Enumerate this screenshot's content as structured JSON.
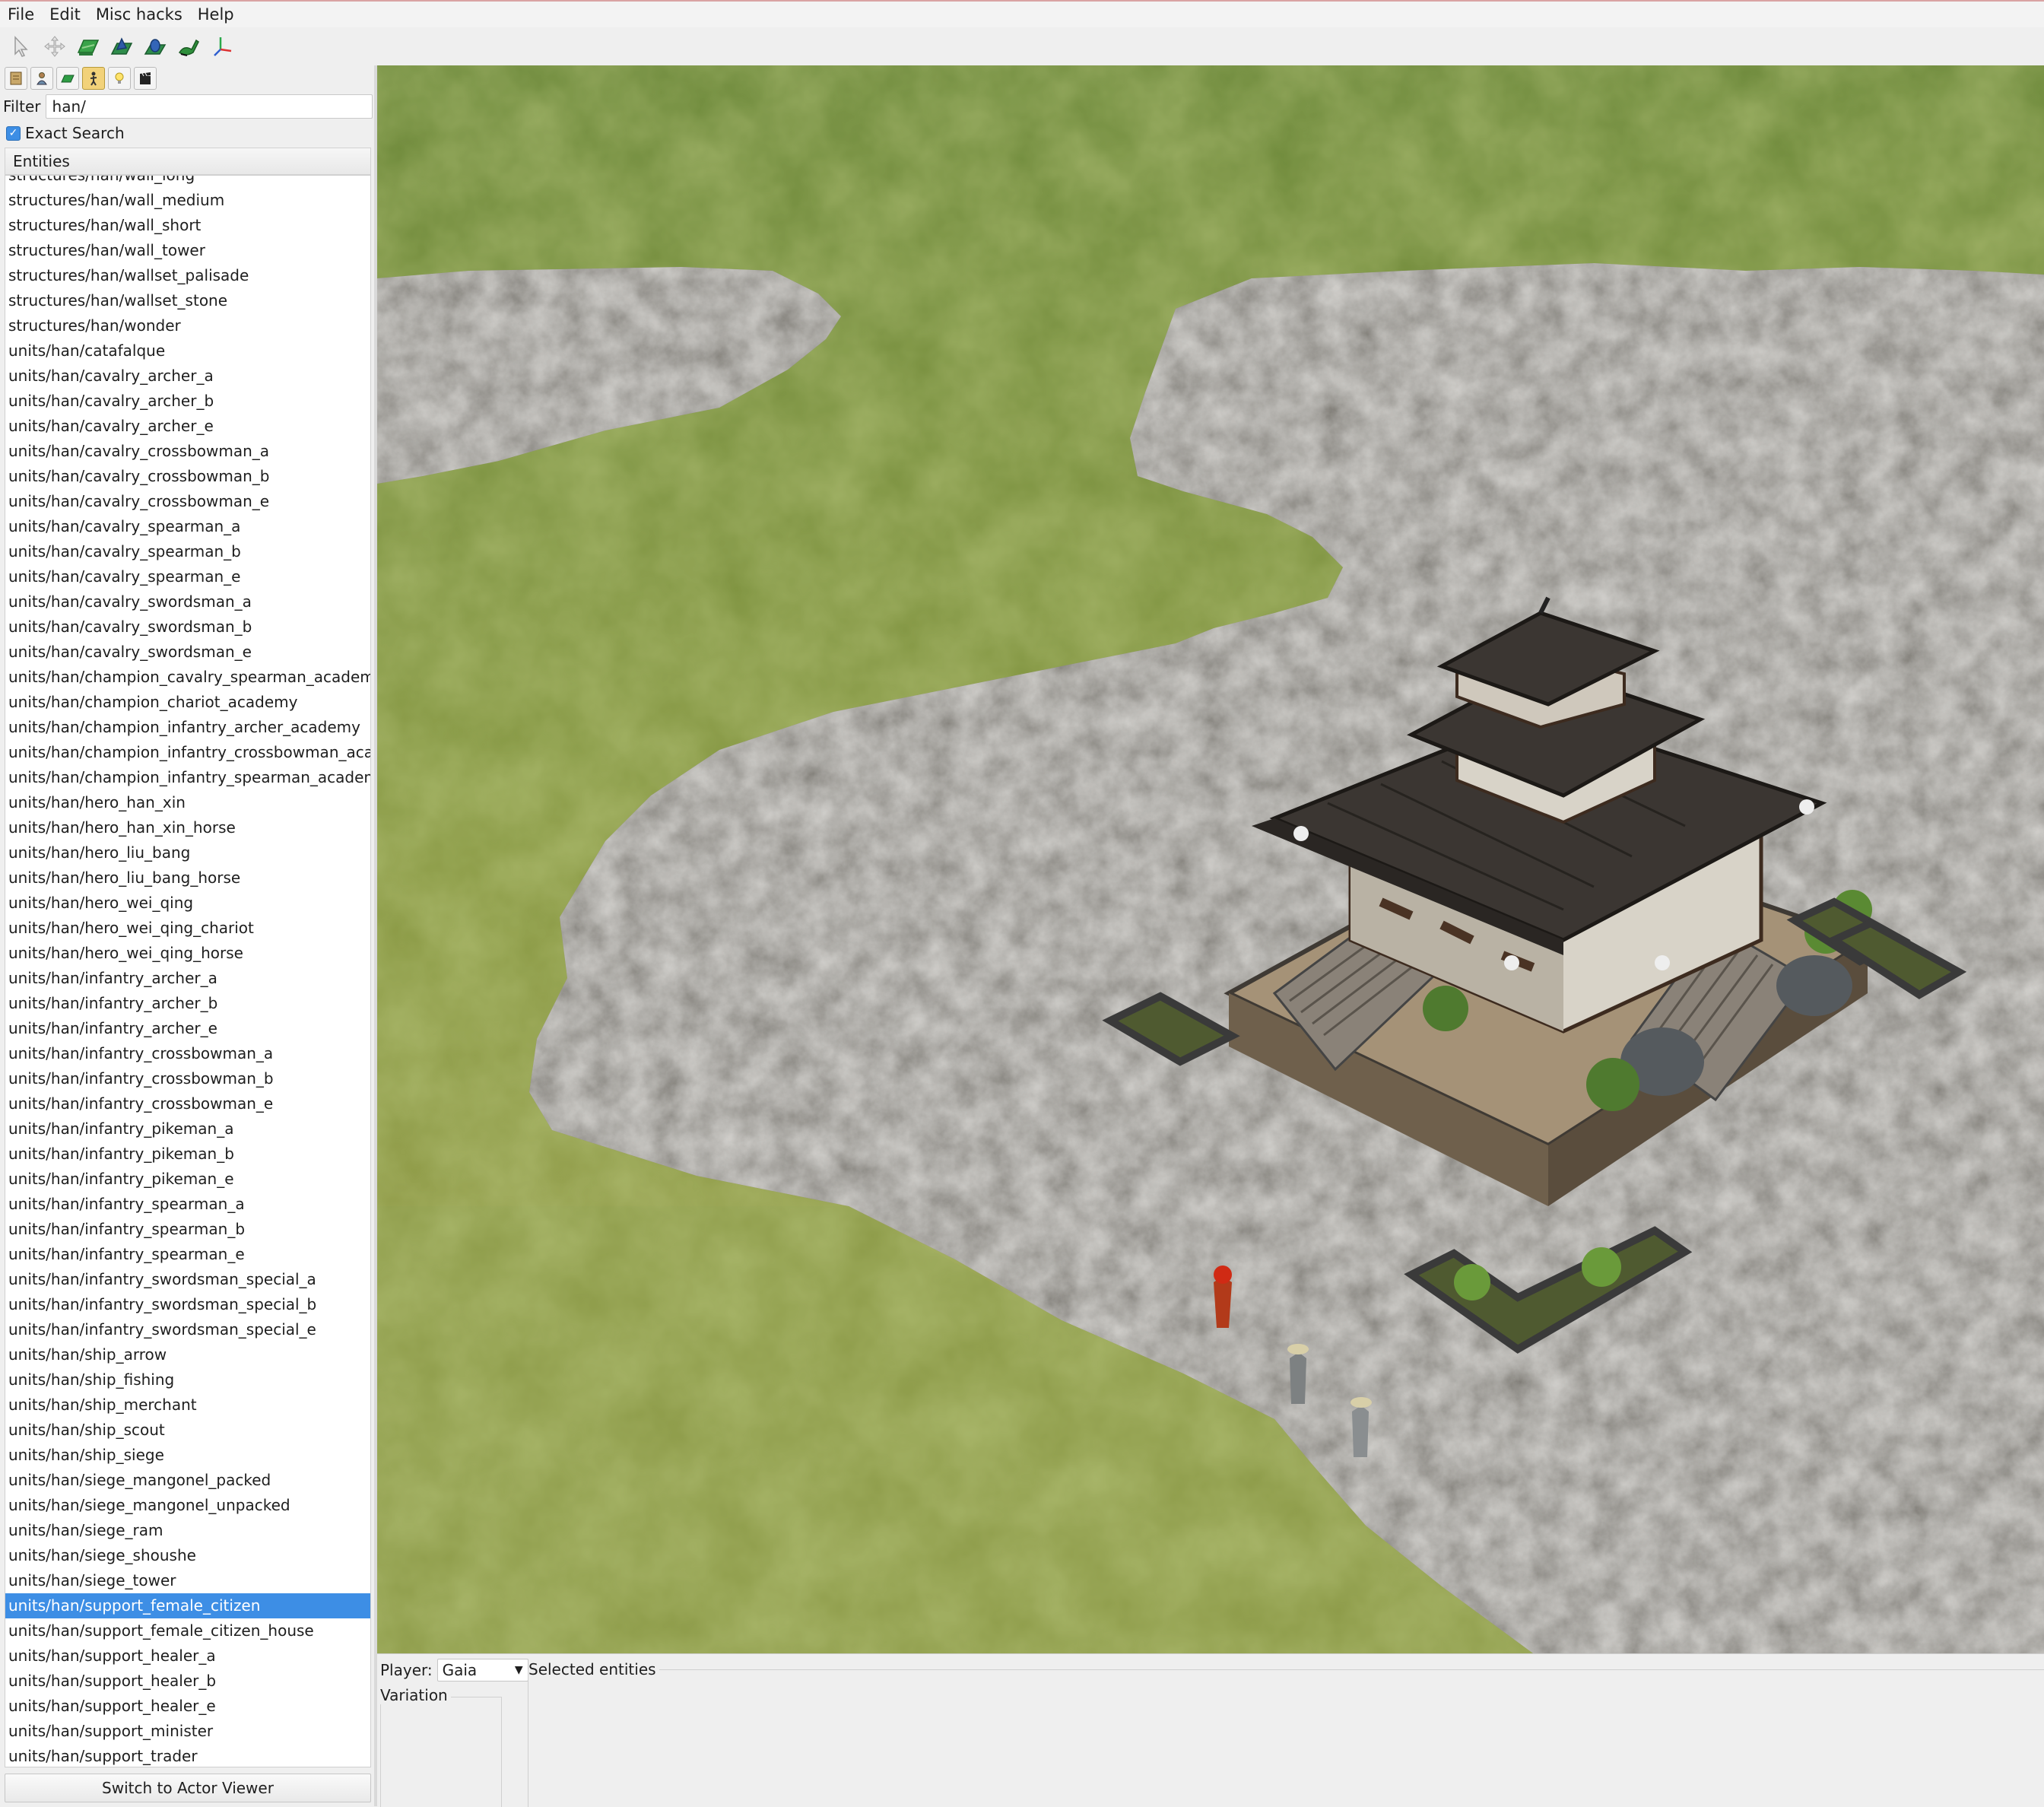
{
  "menu": {
    "items": [
      "File",
      "Edit",
      "Misc hacks",
      "Help"
    ]
  },
  "toolbar": {
    "tools": [
      "select-icon",
      "move-icon",
      "terrain-icon",
      "elevation-icon",
      "smooth-icon",
      "paint-icon",
      "axis-icon"
    ]
  },
  "panel_tabs": [
    "map-icon",
    "player-icon",
    "terrain-tab-icon",
    "object-icon",
    "light-icon",
    "cinema-icon"
  ],
  "filter": {
    "label": "Filter",
    "value": "han/"
  },
  "exact_search": {
    "label": "Exact Search",
    "checked": true
  },
  "entities": {
    "header": "Entities",
    "items": [
      "structures/han/wall_long",
      "structures/han/wall_medium",
      "structures/han/wall_short",
      "structures/han/wall_tower",
      "structures/han/wallset_palisade",
      "structures/han/wallset_stone",
      "structures/han/wonder",
      "units/han/catafalque",
      "units/han/cavalry_archer_a",
      "units/han/cavalry_archer_b",
      "units/han/cavalry_archer_e",
      "units/han/cavalry_crossbowman_a",
      "units/han/cavalry_crossbowman_b",
      "units/han/cavalry_crossbowman_e",
      "units/han/cavalry_spearman_a",
      "units/han/cavalry_spearman_b",
      "units/han/cavalry_spearman_e",
      "units/han/cavalry_swordsman_a",
      "units/han/cavalry_swordsman_b",
      "units/han/cavalry_swordsman_e",
      "units/han/champion_cavalry_spearman_academy",
      "units/han/champion_chariot_academy",
      "units/han/champion_infantry_archer_academy",
      "units/han/champion_infantry_crossbowman_academy",
      "units/han/champion_infantry_spearman_academy",
      "units/han/hero_han_xin",
      "units/han/hero_han_xin_horse",
      "units/han/hero_liu_bang",
      "units/han/hero_liu_bang_horse",
      "units/han/hero_wei_qing",
      "units/han/hero_wei_qing_chariot",
      "units/han/hero_wei_qing_horse",
      "units/han/infantry_archer_a",
      "units/han/infantry_archer_b",
      "units/han/infantry_archer_e",
      "units/han/infantry_crossbowman_a",
      "units/han/infantry_crossbowman_b",
      "units/han/infantry_crossbowman_e",
      "units/han/infantry_pikeman_a",
      "units/han/infantry_pikeman_b",
      "units/han/infantry_pikeman_e",
      "units/han/infantry_spearman_a",
      "units/han/infantry_spearman_b",
      "units/han/infantry_spearman_e",
      "units/han/infantry_swordsman_special_a",
      "units/han/infantry_swordsman_special_b",
      "units/han/infantry_swordsman_special_e",
      "units/han/ship_arrow",
      "units/han/ship_fishing",
      "units/han/ship_merchant",
      "units/han/ship_scout",
      "units/han/ship_siege",
      "units/han/siege_mangonel_packed",
      "units/han/siege_mangonel_unpacked",
      "units/han/siege_ram",
      "units/han/siege_shoushe",
      "units/han/siege_tower",
      "units/han/support_female_citizen",
      "units/han/support_female_citizen_house",
      "units/han/support_healer_a",
      "units/han/support_healer_b",
      "units/han/support_healer_e",
      "units/han/support_minister",
      "units/han/support_trader"
    ],
    "selected": "units/han/support_female_citizen"
  },
  "switch_button": "Switch to Actor Viewer",
  "bottom": {
    "player_label": "Player:",
    "player_value": "Gaia",
    "variation_label": "Variation",
    "selected_label": "Selected entities"
  },
  "colors": {
    "selection": "#3d8ee5",
    "grass": "#86963f",
    "rock": "#7d7a73"
  }
}
